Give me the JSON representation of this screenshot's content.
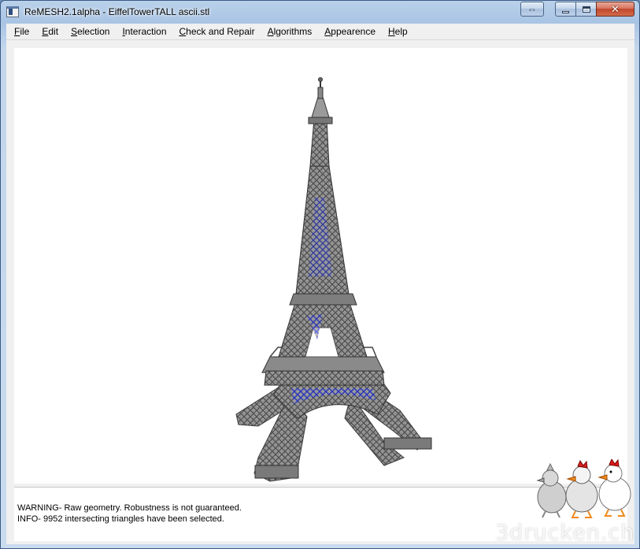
{
  "window": {
    "title": "ReMESH2.1alpha - EiffelTowerTALL ascii.stl"
  },
  "titlebar_buttons": {
    "swap_icon": "arrow-swap-icon",
    "minimize_icon": "minimize-icon",
    "maximize_icon": "maximize-icon",
    "close_icon": "close-icon"
  },
  "menu": {
    "items": [
      "File",
      "Edit",
      "Selection",
      "Interaction",
      "Check and Repair",
      "Algorithms",
      "Appearence",
      "Help"
    ]
  },
  "console": {
    "lines": [
      "WARNING- Raw geometry. Robustness is not guaranteed.",
      "INFO- 9952 intersecting triangles have been selected."
    ]
  },
  "watermark": {
    "text": "3drucken.ch"
  },
  "colors": {
    "mesh": "#8c8c8c",
    "mesh_dark": "#4a4a4a",
    "selection": "#1c2bd6",
    "viewport_bg": "#ffffff"
  }
}
